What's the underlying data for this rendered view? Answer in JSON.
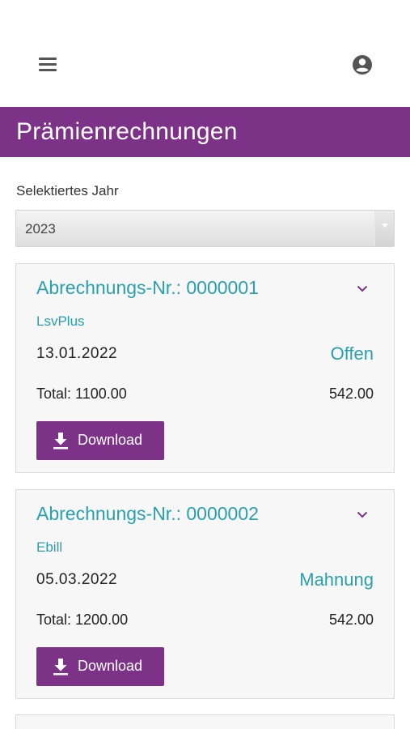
{
  "header": {
    "menu_icon": "hamburger-menu-icon",
    "account_icon": "account-circle-icon"
  },
  "page": {
    "title": "Prämienrechnungen"
  },
  "year_filter": {
    "label": "Selektiertes Jahr",
    "selected": "2023"
  },
  "invoices": [
    {
      "number_label": "Abrechnungs-Nr.: 0000001",
      "type": "LsvPlus",
      "date": "13.01.2022",
      "status": "Offen",
      "total": "Total: 1100.00",
      "amount": "542.00",
      "download_label": "Download"
    },
    {
      "number_label": "Abrechnungs-Nr.: 0000002",
      "type": "Ebill",
      "date": "05.03.2022",
      "status": "Mahnung",
      "total": "Total: 1200.00",
      "amount": "542.00",
      "download_label": "Download"
    }
  ],
  "colors": {
    "brand": "#7c3286",
    "accent": "#2aa0ac"
  }
}
